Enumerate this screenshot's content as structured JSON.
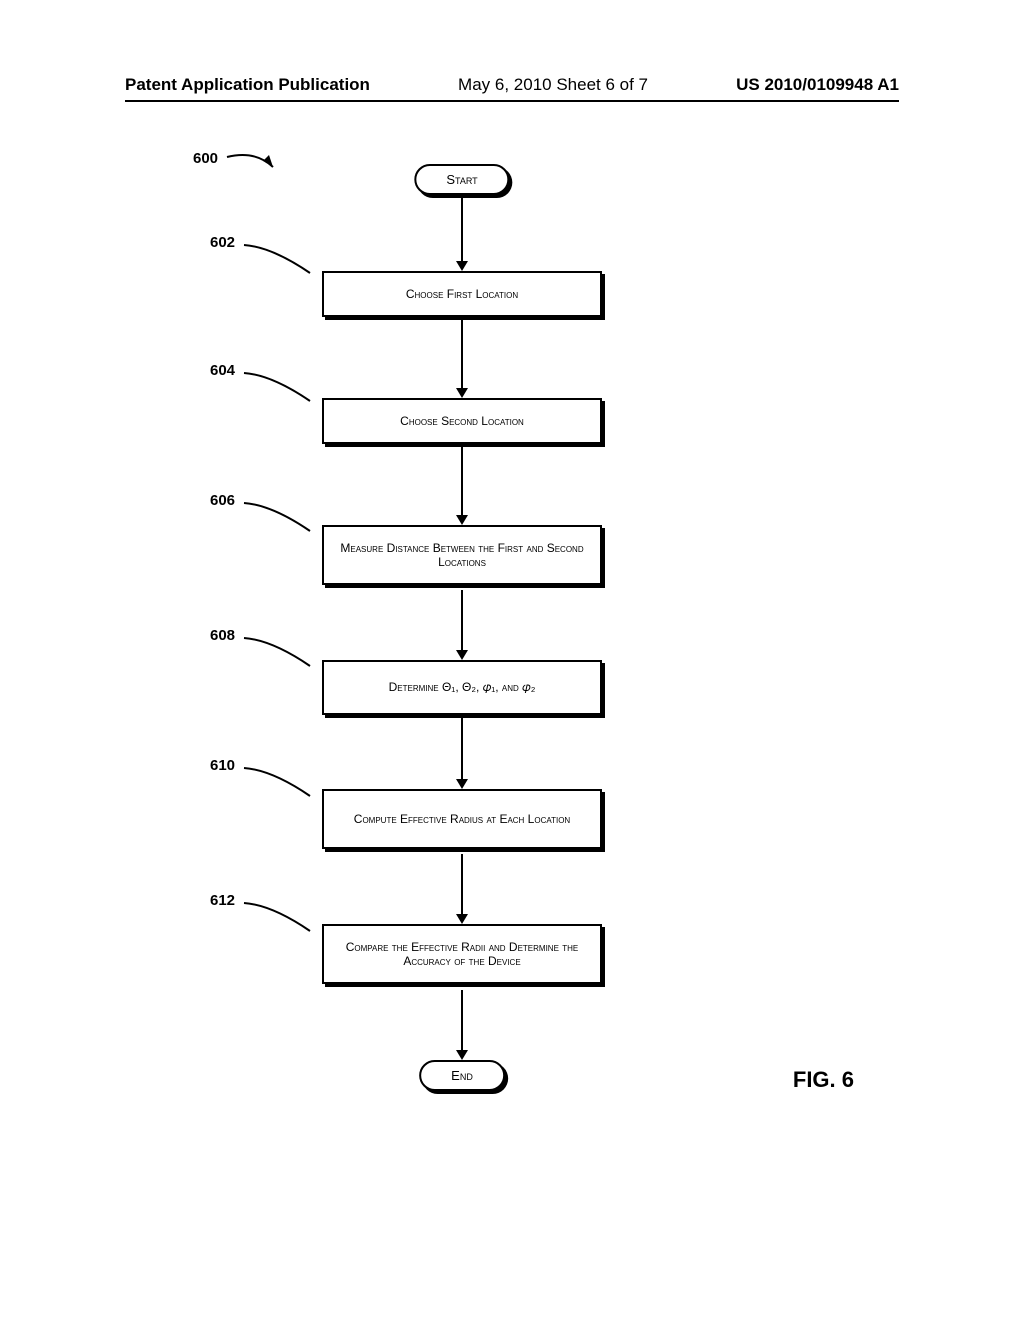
{
  "header": {
    "left": "Patent Application Publication",
    "center": "May 6, 2010  Sheet 6 of 7",
    "right": "US 2010/0109948 A1"
  },
  "figure_label": "FIG. 6",
  "refs": {
    "r600": "600",
    "r602": "602",
    "r604": "604",
    "r606": "606",
    "r608": "608",
    "r610": "610",
    "r612": "612"
  },
  "flowchart": {
    "start": "Start",
    "end": "End",
    "step602": "Choose First Location",
    "step604": "Choose Second Location",
    "step606": "Measure Distance Between the First and Second Locations",
    "step608": "Determine Θ₁, Θ₂, 𝜑₁, and 𝜑₂",
    "step610": "Compute Effective Radius at Each Location",
    "step612": "Compare the Effective Radii and Determine the Accuracy of the Device"
  },
  "chart_data": {
    "type": "flowchart",
    "title": "FIG. 6",
    "nodes": [
      {
        "id": "600",
        "type": "entry-pointer",
        "label": "600"
      },
      {
        "id": "start",
        "type": "terminal",
        "label": "Start"
      },
      {
        "id": "602",
        "type": "process",
        "label": "Choose First Location"
      },
      {
        "id": "604",
        "type": "process",
        "label": "Choose Second Location"
      },
      {
        "id": "606",
        "type": "process",
        "label": "Measure Distance Between the First and Second Locations"
      },
      {
        "id": "608",
        "type": "process",
        "label": "Determine Θ₁, Θ₂, 𝜑₁, and 𝜑₂"
      },
      {
        "id": "610",
        "type": "process",
        "label": "Compute Effective Radius at Each Location"
      },
      {
        "id": "612",
        "type": "process",
        "label": "Compare the Effective Radii and Determine the Accuracy of the Device"
      },
      {
        "id": "end",
        "type": "terminal",
        "label": "End"
      }
    ],
    "edges": [
      {
        "from": "600",
        "to": "start"
      },
      {
        "from": "start",
        "to": "602"
      },
      {
        "from": "602",
        "to": "604"
      },
      {
        "from": "604",
        "to": "606"
      },
      {
        "from": "606",
        "to": "608"
      },
      {
        "from": "608",
        "to": "610"
      },
      {
        "from": "610",
        "to": "612"
      },
      {
        "from": "612",
        "to": "end"
      }
    ]
  }
}
